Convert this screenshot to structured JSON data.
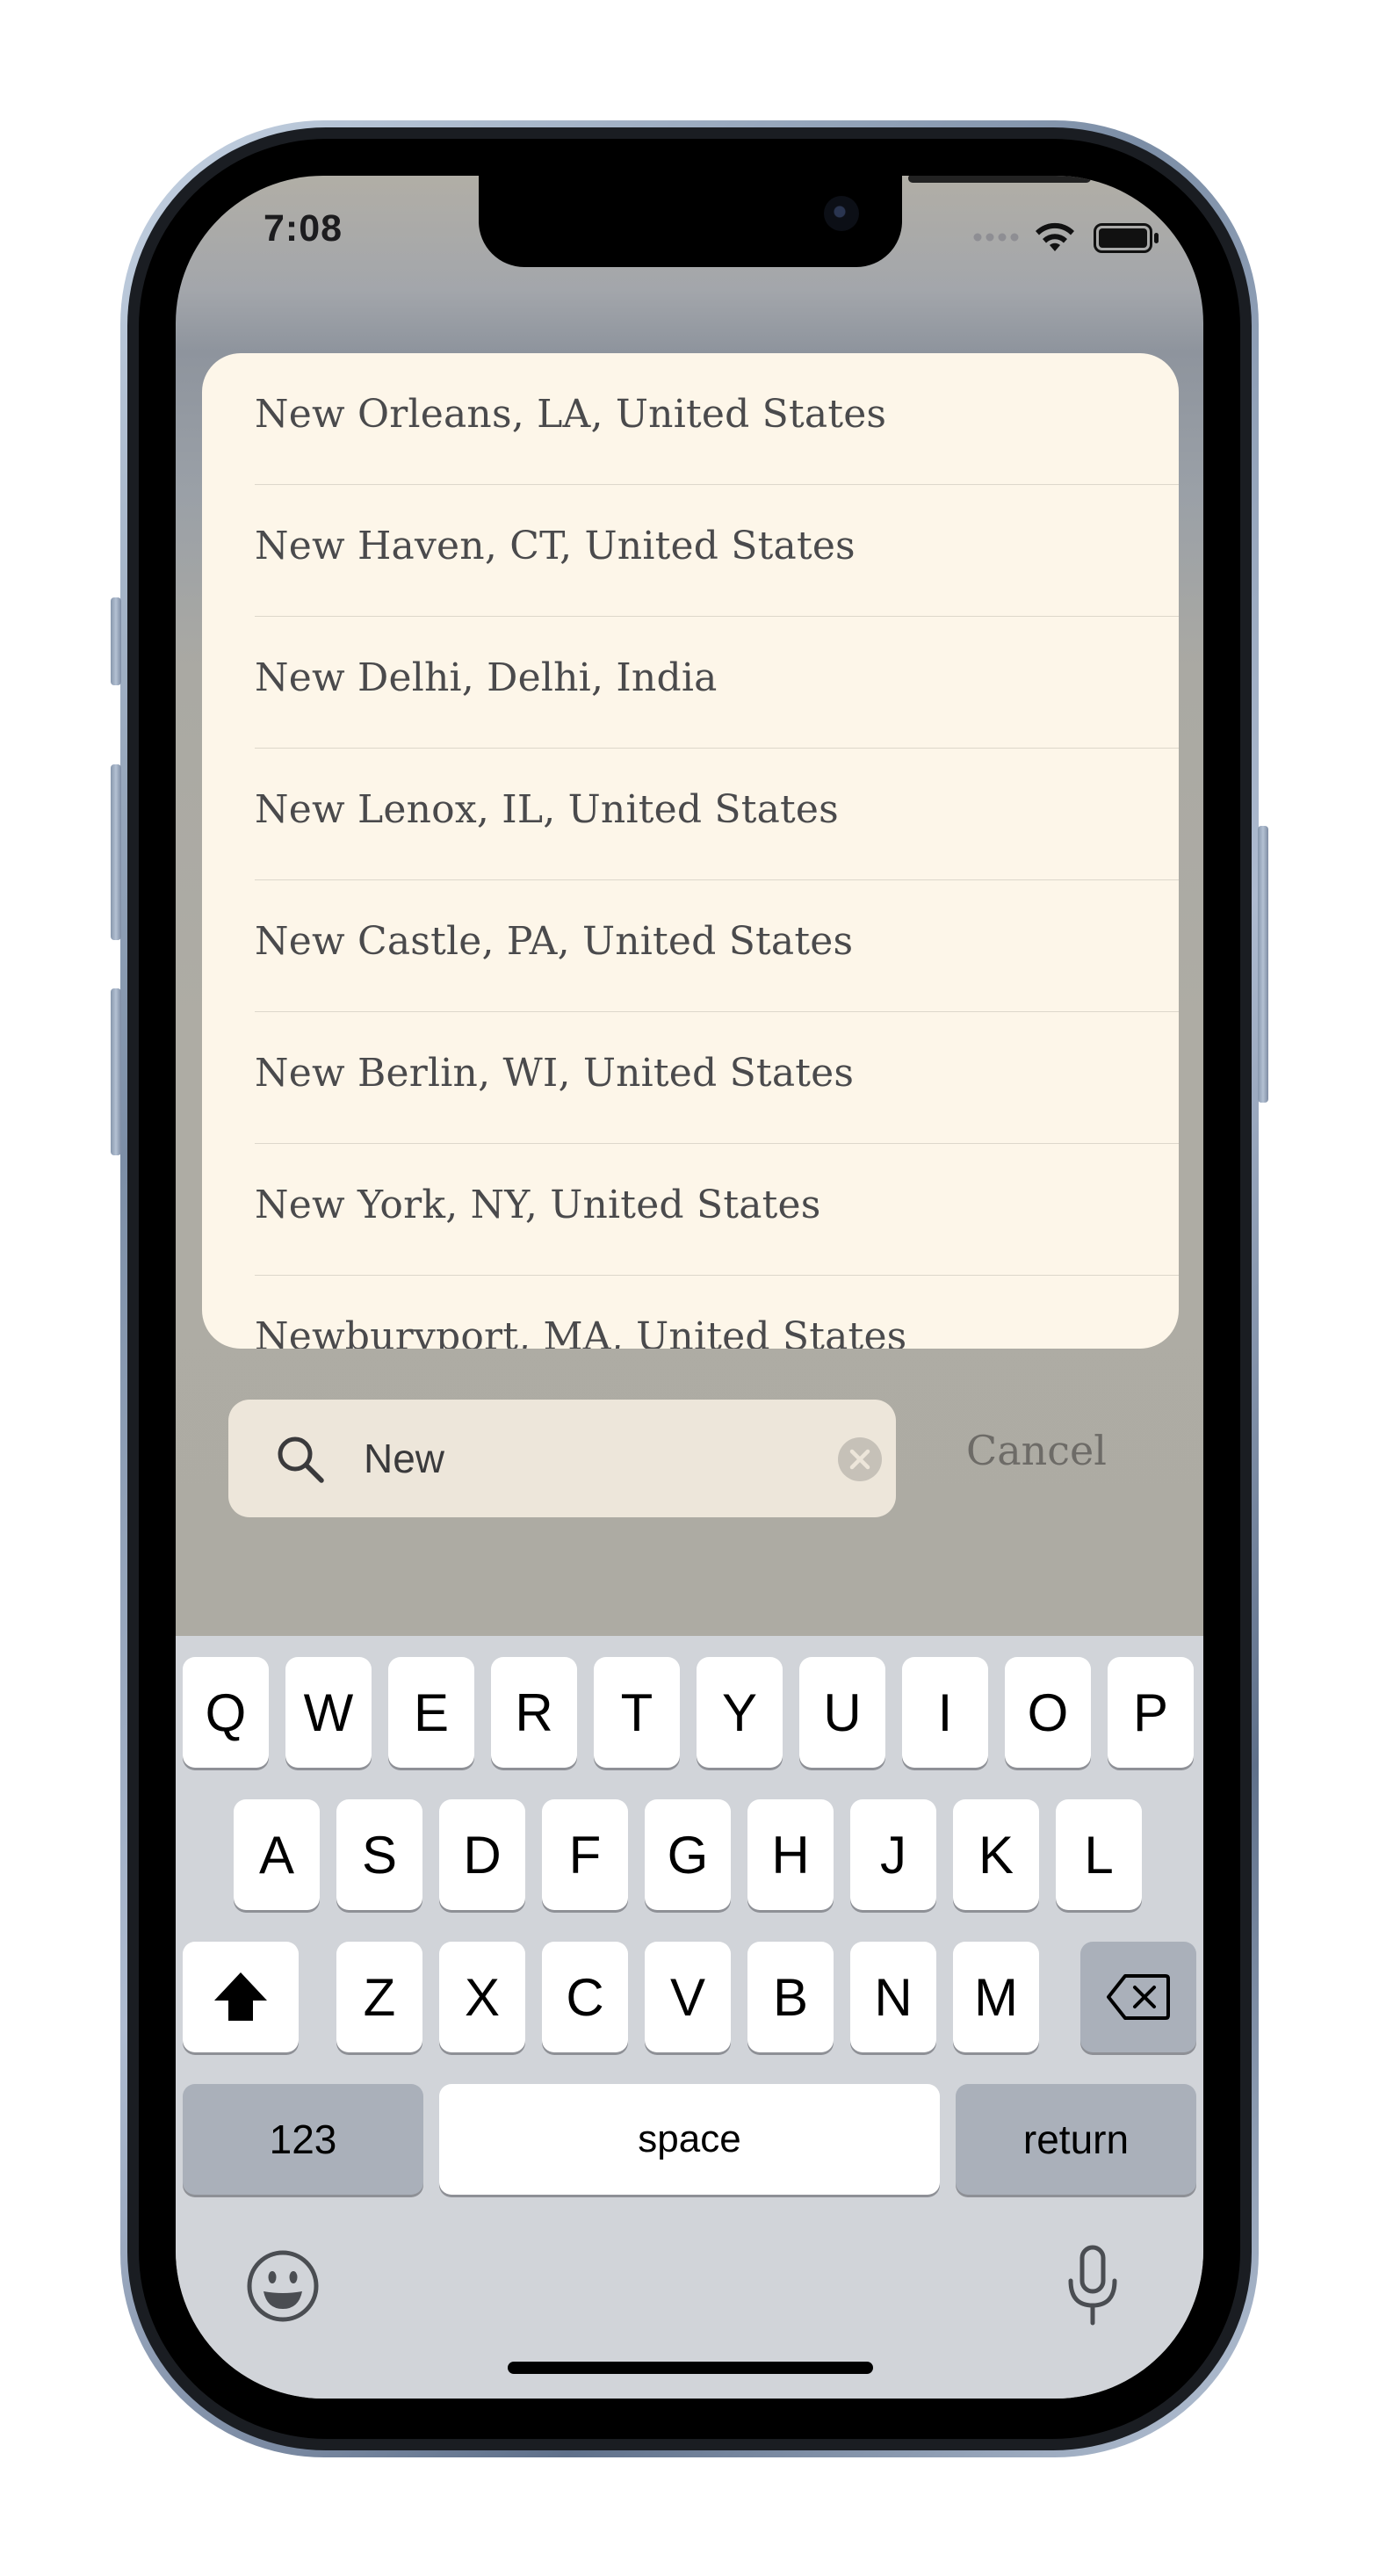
{
  "status_bar": {
    "time": "7:08",
    "icons": [
      "signal-icon",
      "wifi-icon",
      "battery-icon"
    ]
  },
  "results": [
    "New Orleans, LA, United States",
    "New Haven, CT, United States",
    "New Delhi, Delhi, India",
    "New Lenox, IL, United States",
    "New Castle, PA, United States",
    "New Berlin, WI, United States",
    "New York, NY, United States",
    "Newburyport, MA, United States"
  ],
  "search": {
    "value": "New",
    "cancel_label": "Cancel"
  },
  "keyboard": {
    "row1": [
      "Q",
      "W",
      "E",
      "R",
      "T",
      "Y",
      "U",
      "I",
      "O",
      "P"
    ],
    "row2": [
      "A",
      "S",
      "D",
      "F",
      "G",
      "H",
      "J",
      "K",
      "L"
    ],
    "row3": [
      "Z",
      "X",
      "C",
      "V",
      "B",
      "N",
      "M"
    ],
    "numbers_label": "123",
    "space_label": "space",
    "return_label": "return"
  },
  "colors": {
    "card_bg": "#fdf6e9",
    "search_bg": "#ede6da",
    "keyboard_bg": "#d1d4d9",
    "key_bg": "#ffffff",
    "key_dark_bg": "#aab0ba"
  }
}
